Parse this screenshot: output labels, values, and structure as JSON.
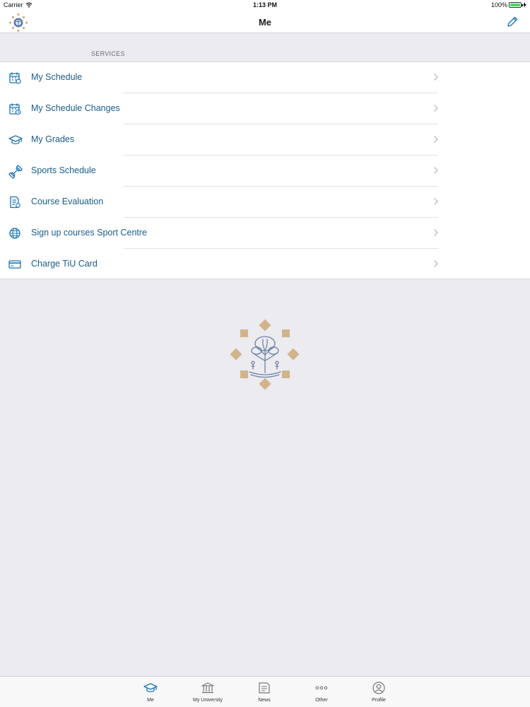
{
  "status_bar": {
    "carrier": "Carrier",
    "time": "1:13 PM",
    "battery": "100%"
  },
  "nav": {
    "title": "Me",
    "edit_icon": "pencil-icon"
  },
  "services": {
    "header": "SERVICES",
    "items": [
      {
        "label": "My Schedule",
        "icon": "calendar-icon"
      },
      {
        "label": "My Schedule Changes",
        "icon": "calendar-changes-icon"
      },
      {
        "label": "My Grades",
        "icon": "graduation-cap-icon"
      },
      {
        "label": "Sports Schedule",
        "icon": "dumbbell-icon"
      },
      {
        "label": "Course Evaluation",
        "icon": "evaluation-form-icon"
      },
      {
        "label": "Sign up courses Sport Centre",
        "icon": "globe-icon"
      },
      {
        "label": "Charge TiU Card",
        "icon": "card-icon"
      }
    ]
  },
  "tabs": [
    {
      "label": "Me",
      "icon": "graduation-cap-icon",
      "active": true
    },
    {
      "label": "My University",
      "icon": "university-icon"
    },
    {
      "label": "News",
      "icon": "news-icon"
    },
    {
      "label": "Other",
      "icon": "more-icon"
    },
    {
      "label": "Profile",
      "icon": "profile-icon"
    }
  ],
  "colors": {
    "accent": "#1a73b5",
    "link": "#1a5c8c",
    "gold": "#d2b48c",
    "background": "#ebebf0"
  }
}
